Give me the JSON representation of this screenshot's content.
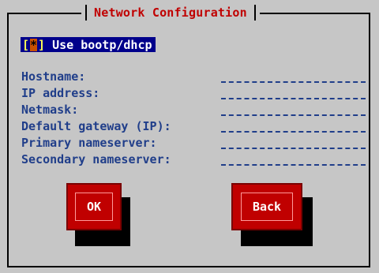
{
  "dialog": {
    "title": "Network Configuration",
    "checkbox": {
      "label": "Use bootp/dhcp",
      "checked": true,
      "mark": "*"
    },
    "fields": [
      {
        "label": "Hostname:",
        "value": ""
      },
      {
        "label": "IP address:",
        "value": ""
      },
      {
        "label": "Netmask:",
        "value": ""
      },
      {
        "label": "Default gateway (IP):",
        "value": ""
      },
      {
        "label": "Primary nameserver:",
        "value": ""
      },
      {
        "label": "Secondary nameserver:",
        "value": ""
      }
    ],
    "buttons": {
      "ok": "OK",
      "back": "Back"
    }
  },
  "colors": {
    "background": "#c6c6c6",
    "title": "#c00000",
    "label": "#203e8a",
    "highlight": "#00008b",
    "button": "#c00000"
  }
}
